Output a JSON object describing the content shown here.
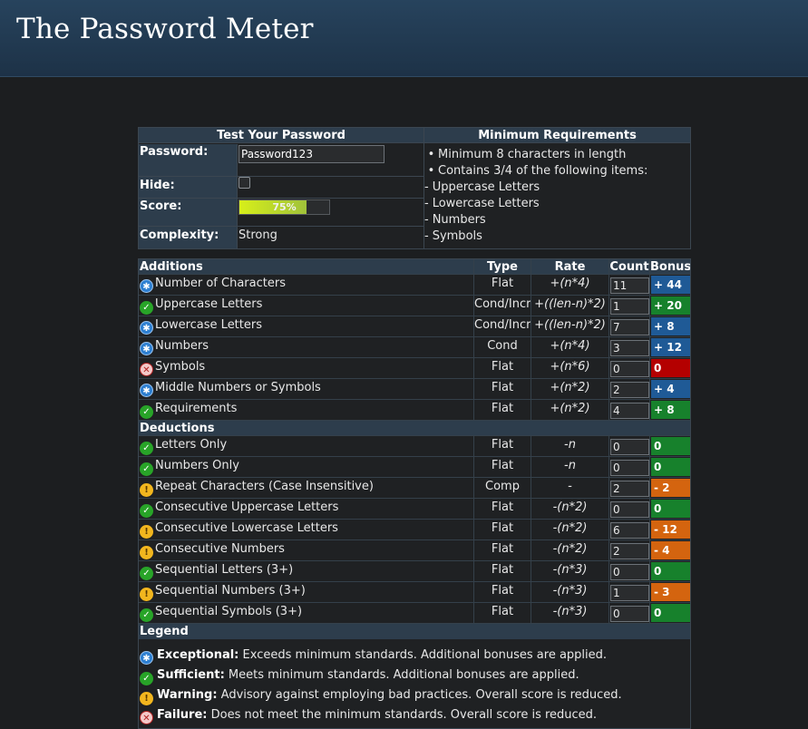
{
  "app": {
    "title": "The Password Meter"
  },
  "colors": {
    "exceptional": "#1f5a96",
    "sufficient": "#17812c",
    "warning": "#d4640f",
    "failure": "#b40000"
  },
  "test_panel": {
    "heading": "Test Your Password",
    "password_label": "Password:",
    "password_value": "Password123",
    "hide_label": "Hide:",
    "score_label": "Score:",
    "score_value": "75%",
    "score_percent": 75,
    "complexity_label": "Complexity:",
    "complexity_value": "Strong"
  },
  "requirements": {
    "heading": "Minimum Requirements",
    "items": [
      {
        "bullet": "•",
        "text": "Minimum 8 characters in length"
      },
      {
        "bullet": "•",
        "text": "Contains 3/4 of the following items:"
      },
      {
        "bullet": "-",
        "text": "Uppercase Letters"
      },
      {
        "bullet": "-",
        "text": "Lowercase Letters"
      },
      {
        "bullet": "-",
        "text": "Numbers"
      },
      {
        "bullet": "-",
        "text": "Symbols"
      }
    ]
  },
  "table": {
    "additions_heading": "Additions",
    "type_heading": "Type",
    "rate_heading": "Rate",
    "count_heading": "Count",
    "bonus_heading": "Bonus",
    "additions": [
      {
        "status": "exceptional",
        "icon": "exceptional-icon",
        "name": "Number of Characters",
        "type": "Flat",
        "rate": "+(n*4)",
        "count": "11",
        "bonus": "+ 44"
      },
      {
        "status": "sufficient",
        "icon": "sufficient-icon",
        "name": "Uppercase Letters",
        "type": "Cond/Incr",
        "rate": "+((len-n)*2)",
        "count": "1",
        "bonus": "+ 20"
      },
      {
        "status": "exceptional",
        "icon": "exceptional-icon",
        "name": "Lowercase Letters",
        "type": "Cond/Incr",
        "rate": "+((len-n)*2)",
        "count": "7",
        "bonus": "+ 8"
      },
      {
        "status": "exceptional",
        "icon": "exceptional-icon",
        "name": "Numbers",
        "type": "Cond",
        "rate": "+(n*4)",
        "count": "3",
        "bonus": "+ 12"
      },
      {
        "status": "failure",
        "icon": "failure-icon",
        "name": "Symbols",
        "type": "Flat",
        "rate": "+(n*6)",
        "count": "0",
        "bonus": "0"
      },
      {
        "status": "exceptional",
        "icon": "exceptional-icon",
        "name": "Middle Numbers or Symbols",
        "type": "Flat",
        "rate": "+(n*2)",
        "count": "2",
        "bonus": "+ 4"
      },
      {
        "status": "sufficient",
        "icon": "sufficient-icon",
        "name": "Requirements",
        "type": "Flat",
        "rate": "+(n*2)",
        "count": "4",
        "bonus": "+ 8"
      }
    ],
    "deductions_heading": "Deductions",
    "deductions": [
      {
        "status": "sufficient",
        "icon": "sufficient-icon",
        "name": "Letters Only",
        "type": "Flat",
        "rate": "-n",
        "count": "0",
        "bonus": "0"
      },
      {
        "status": "sufficient",
        "icon": "sufficient-icon",
        "name": "Numbers Only",
        "type": "Flat",
        "rate": "-n",
        "count": "0",
        "bonus": "0"
      },
      {
        "status": "warning",
        "icon": "warning-icon",
        "name": "Repeat Characters (Case Insensitive)",
        "type": "Comp",
        "rate": "-",
        "count": "2",
        "bonus": "- 2"
      },
      {
        "status": "sufficient",
        "icon": "sufficient-icon",
        "name": "Consecutive Uppercase Letters",
        "type": "Flat",
        "rate": "-(n*2)",
        "count": "0",
        "bonus": "0"
      },
      {
        "status": "warning",
        "icon": "warning-icon",
        "name": "Consecutive Lowercase Letters",
        "type": "Flat",
        "rate": "-(n*2)",
        "count": "6",
        "bonus": "- 12"
      },
      {
        "status": "warning",
        "icon": "warning-icon",
        "name": "Consecutive Numbers",
        "type": "Flat",
        "rate": "-(n*2)",
        "count": "2",
        "bonus": "- 4"
      },
      {
        "status": "sufficient",
        "icon": "sufficient-icon",
        "name": "Sequential Letters (3+)",
        "type": "Flat",
        "rate": "-(n*3)",
        "count": "0",
        "bonus": "0"
      },
      {
        "status": "warning",
        "icon": "warning-icon",
        "name": "Sequential Numbers (3+)",
        "type": "Flat",
        "rate": "-(n*3)",
        "count": "1",
        "bonus": "- 3"
      },
      {
        "status": "sufficient",
        "icon": "sufficient-icon",
        "name": "Sequential Symbols (3+)",
        "type": "Flat",
        "rate": "-(n*3)",
        "count": "0",
        "bonus": "0"
      }
    ],
    "legend_heading": "Legend",
    "legend": [
      {
        "status": "exceptional",
        "icon": "exceptional-icon",
        "term": "Exceptional:",
        "desc": "Exceeds minimum standards. Additional bonuses are applied."
      },
      {
        "status": "sufficient",
        "icon": "sufficient-icon",
        "term": "Sufficient:",
        "desc": "Meets minimum standards. Additional bonuses are applied."
      },
      {
        "status": "warning",
        "icon": "warning-icon",
        "term": "Warning:",
        "desc": "Advisory against employing bad practices. Overall score is reduced."
      },
      {
        "status": "failure",
        "icon": "failure-icon",
        "term": "Failure:",
        "desc": "Does not meet the minimum standards. Overall score is reduced."
      }
    ]
  }
}
